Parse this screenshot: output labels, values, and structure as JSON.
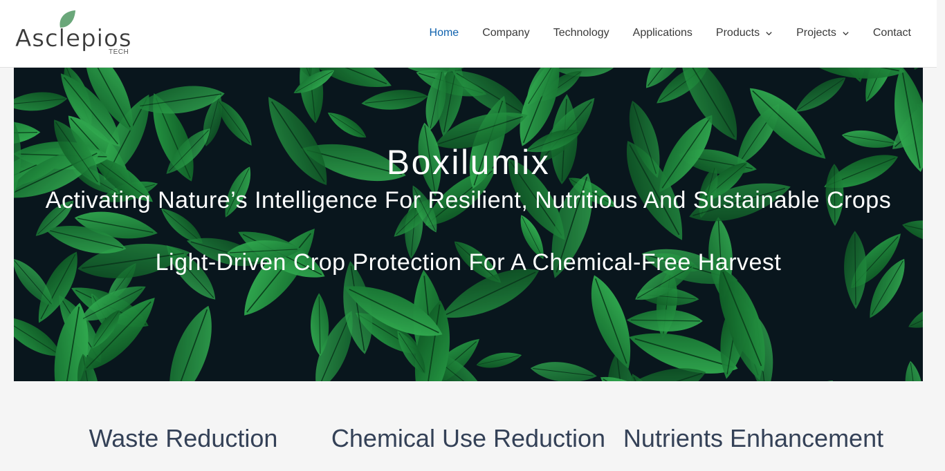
{
  "logo": {
    "text": "Asclepios",
    "tag": "TECH"
  },
  "nav": {
    "items": [
      {
        "label": "Home",
        "active": true
      },
      {
        "label": "Company"
      },
      {
        "label": "Technology"
      },
      {
        "label": "Applications"
      },
      {
        "label": "Products",
        "dropdown": true
      },
      {
        "label": "Projects",
        "dropdown": true
      },
      {
        "label": "Contact"
      }
    ]
  },
  "hero": {
    "title": "Boxilumix",
    "subtitle": "Activating Nature’s Intelligence For Resilient, Nutritious And Sustainable Crops",
    "tagline": "Light-Driven Crop Protection For A Chemical-Free Harvest"
  },
  "features": [
    {
      "title": "Waste Reduction"
    },
    {
      "title": "Chemical Use Reduction"
    },
    {
      "title": "Nutrients Enhancement"
    }
  ],
  "colors": {
    "accent": "#0f62ae",
    "text": "#3a3a3a",
    "heading": "#344157",
    "leaf": "#2ea84f"
  }
}
